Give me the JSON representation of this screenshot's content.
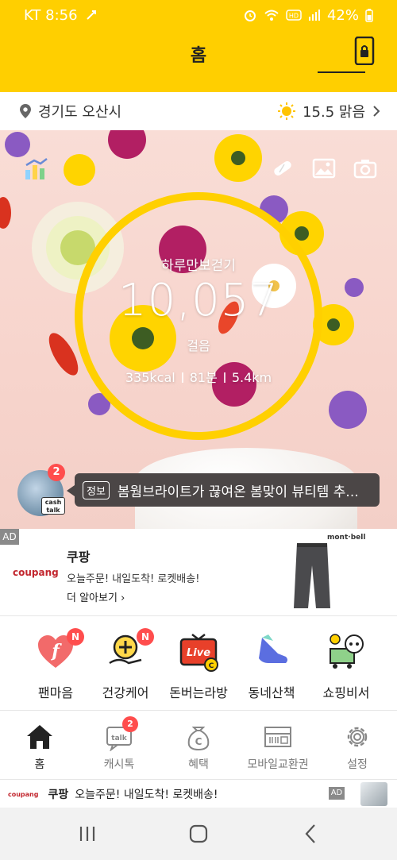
{
  "status_bar": {
    "carrier_time": "KT 8:56",
    "battery": "42%"
  },
  "header": {
    "title": "홈"
  },
  "location": {
    "city": "경기도 오산시",
    "weather": "15.5 맑음"
  },
  "steps": {
    "label": "하루만보걷기",
    "count": "10,057",
    "unit": "걸음",
    "kcal": "335kcal",
    "minutes": "81분",
    "distance": "5.4km"
  },
  "notice": {
    "badge_count": "2",
    "tag": "정보",
    "text": "봄웜브라이트가 끊여온 봄맞이 뷰티템 추...",
    "mascot_label": "cash talk"
  },
  "ad": {
    "tag": "AD",
    "logo": "coupang",
    "name": "쿠팡",
    "desc": "오늘주문! 내일도착! 로켓배송!",
    "more": "더 알아보기 ›",
    "brand": "mont·bell"
  },
  "quick_menu": [
    {
      "label": "팬마음",
      "icon": "heart-f-icon",
      "badge": "N"
    },
    {
      "label": "건강케어",
      "icon": "health-care-icon",
      "badge": "N"
    },
    {
      "label": "돈버는라방",
      "icon": "live-tv-icon",
      "badge": ""
    },
    {
      "label": "동네산책",
      "icon": "sneaker-icon",
      "badge": ""
    },
    {
      "label": "쇼핑비서",
      "icon": "shopping-mascot-icon",
      "badge": ""
    }
  ],
  "tabs": [
    {
      "label": "홈",
      "icon": "home-icon",
      "active": true
    },
    {
      "label": "캐시톡",
      "icon": "talk-icon",
      "badge": "2"
    },
    {
      "label": "혜택",
      "icon": "coin-bag-icon"
    },
    {
      "label": "모바일교환권",
      "icon": "voucher-icon"
    },
    {
      "label": "설정",
      "icon": "gear-icon"
    }
  ],
  "banner": {
    "logo": "coupang",
    "name": "쿠팡",
    "text": "오늘주문! 내일도착! 로켓배송!",
    "tag": "AD"
  },
  "colors": {
    "brand_yellow": "#ffcf00",
    "badge_red": "#ff4d4d",
    "notice_bg": "#4b4646"
  }
}
